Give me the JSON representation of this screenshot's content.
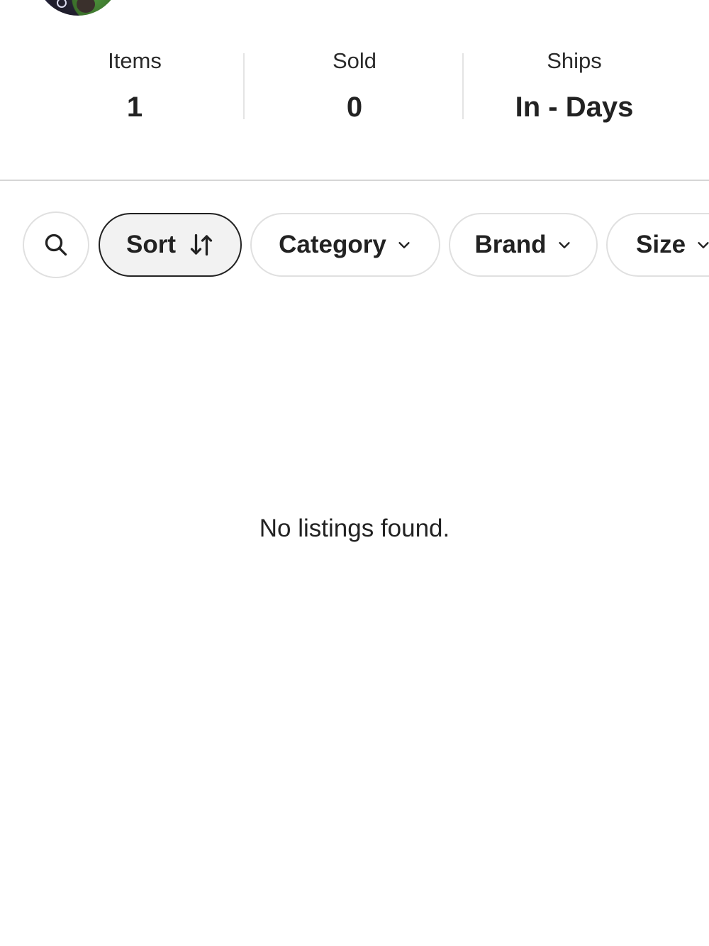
{
  "profile": {
    "avatar_icon": "avatar-photo"
  },
  "stats": {
    "items": {
      "label": "Items",
      "value": "1"
    },
    "sold": {
      "label": "Sold",
      "value": "0"
    },
    "ships": {
      "label": "Ships",
      "value": "In - Days"
    }
  },
  "filters": {
    "search_icon": "search-icon",
    "sort": {
      "label": "Sort",
      "icon": "sort-arrows-icon"
    },
    "category": {
      "label": "Category",
      "icon": "chevron-down-icon"
    },
    "brand": {
      "label": "Brand",
      "icon": "chevron-down-icon"
    },
    "size": {
      "label": "Size",
      "icon": "chevron-down-icon"
    }
  },
  "listings": {
    "empty_message": "No listings found."
  },
  "colors": {
    "text": "#222222",
    "border": "#e0e0e0",
    "sort_active_bg": "#f2f2f2"
  }
}
